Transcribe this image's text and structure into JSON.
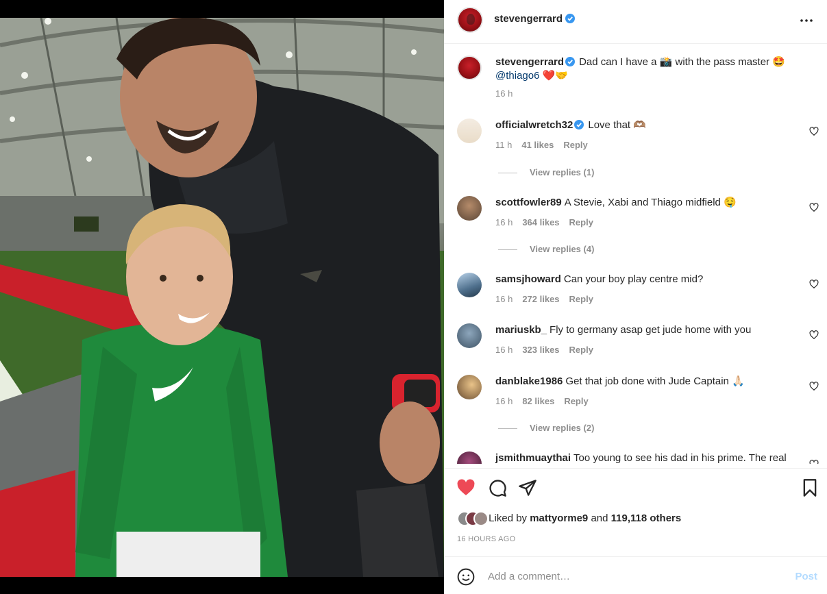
{
  "post": {
    "author": "stevengerrard",
    "caption": "Dad can I have a 📸 with the pass master 🤩",
    "caption_mention": "@thiago6",
    "caption_tail": " ❤️🤝",
    "time": "16 h"
  },
  "icons": {
    "more": "more-horizontal-icon",
    "verified": "verified-badge-icon",
    "like": "heart-filled-icon",
    "comment": "comment-bubble-icon",
    "share": "paper-plane-icon",
    "save": "bookmark-icon",
    "emoji": "emoji-smile-icon"
  },
  "colors": {
    "like": "#ed4956",
    "verified": "#3897f0",
    "link": "#00376b",
    "post_disabled": "#b3dbff"
  },
  "comments": [
    {
      "user": "officialwretch32",
      "verified": true,
      "text": "Love that 🫶🏽",
      "time": "11 h",
      "likes": "41 likes",
      "reply": "Reply",
      "view_replies": "View replies (1)"
    },
    {
      "user": "scottfowler89",
      "verified": false,
      "text": "A Stevie, Xabi and Thiago midfield 🤤",
      "time": "16 h",
      "likes": "364 likes",
      "reply": "Reply",
      "view_replies": "View replies (4)"
    },
    {
      "user": "samsjhoward",
      "verified": false,
      "text": "Can your boy play centre mid?",
      "time": "16 h",
      "likes": "272 likes",
      "reply": "Reply"
    },
    {
      "user": "mariuskb_",
      "verified": false,
      "text": "Fly to germany asap get jude home with you",
      "time": "16 h",
      "likes": "323 likes",
      "reply": "Reply"
    },
    {
      "user": "danblake1986",
      "verified": false,
      "text": "Get that job done with Jude Captain 🙏🏻",
      "time": "16 h",
      "likes": "82 likes",
      "reply": "Reply",
      "view_replies": "View replies (2)"
    },
    {
      "user": "jsmithmuaythai",
      "verified": false,
      "text": "Too young to see his dad in his prime. The real"
    }
  ],
  "likes": {
    "prefix": "Liked by",
    "user": "mattyorme9",
    "joiner": "and",
    "others": "119,118 others"
  },
  "timestamp": "16 HOURS AGO",
  "composer": {
    "placeholder": "Add a comment…",
    "post_label": "Post"
  }
}
